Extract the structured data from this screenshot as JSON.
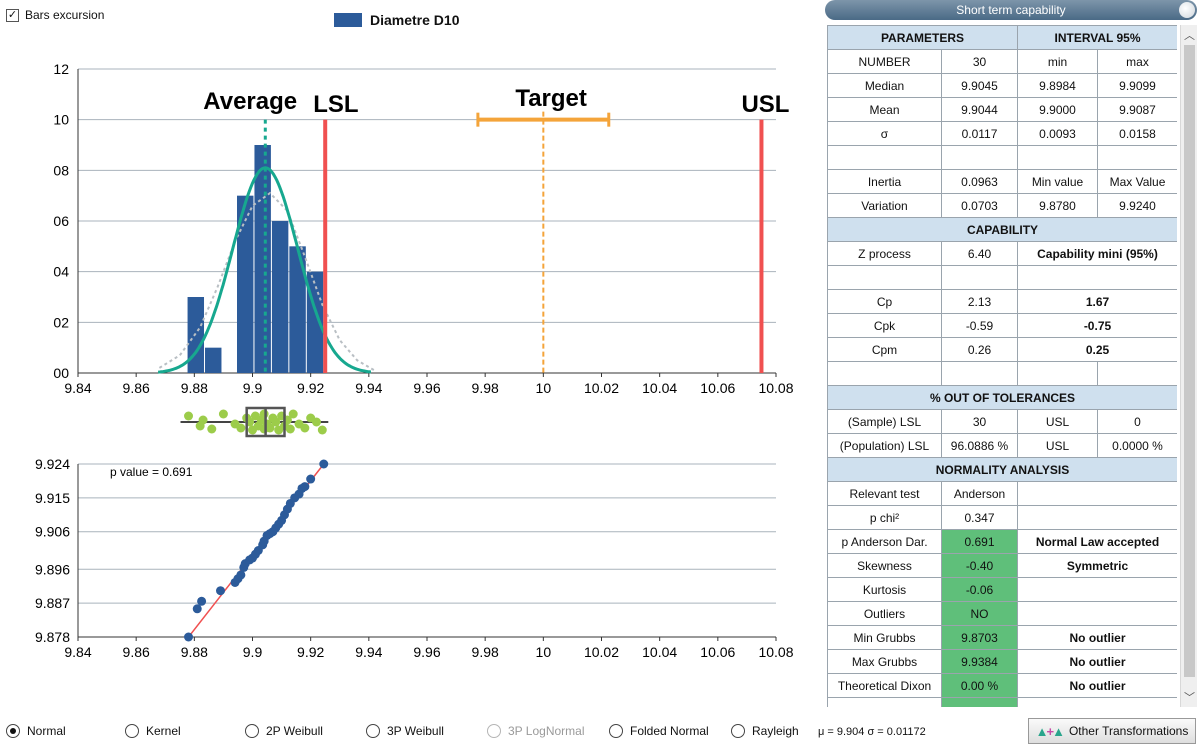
{
  "bars_excursion_label": "Bars excursion",
  "legend_label": "Diametre D10",
  "colors": {
    "bar": "#2c5b9a",
    "normal_curve": "#17a88f",
    "kernel_curve": "#b9bfc4",
    "average_line": "#17a88f",
    "spec_line": "#f05050",
    "target": "#f4a43a",
    "box_points": "#9ccc4a",
    "green_cell": "#5fbf7a",
    "fit_line": "#f05050"
  },
  "chart_data": [
    {
      "type": "bar",
      "legend": "Diametre D10",
      "bins": [
        {
          "x0": 9.8775,
          "x1": 9.8835,
          "value": 3
        },
        {
          "x0": 9.8835,
          "x1": 9.8895,
          "value": 1
        },
        {
          "x0": 9.8945,
          "x1": 9.9005,
          "value": 7
        },
        {
          "x0": 9.9005,
          "x1": 9.9065,
          "value": 9
        },
        {
          "x0": 9.9065,
          "x1": 9.9125,
          "value": 6
        },
        {
          "x0": 9.9125,
          "x1": 9.9185,
          "value": 5
        },
        {
          "x0": 9.9185,
          "x1": 9.9245,
          "value": 4
        }
      ],
      "normal_curve": {
        "mean": 9.9044,
        "sigma": 0.01117,
        "peak": 8.1
      },
      "kernel_curve": [
        [
          9.868,
          0.2
        ],
        [
          9.875,
          0.7
        ],
        [
          9.882,
          1.8
        ],
        [
          9.888,
          3.4
        ],
        [
          9.894,
          5.2
        ],
        [
          9.9,
          6.6
        ],
        [
          9.906,
          7.1
        ],
        [
          9.912,
          6.4
        ],
        [
          9.918,
          4.6
        ],
        [
          9.924,
          2.7
        ],
        [
          9.93,
          1.3
        ],
        [
          9.936,
          0.5
        ],
        [
          9.942,
          0.1
        ]
      ],
      "xlim": [
        9.84,
        10.08
      ],
      "ylim": [
        0,
        12
      ],
      "x_ticks": [
        "9.84",
        "9.86",
        "9.88",
        "9.9",
        "9.92",
        "9.94",
        "9.96",
        "9.98",
        "10",
        "10.02",
        "10.04",
        "10.06",
        "10.08"
      ],
      "x_tick_values": [
        9.84,
        9.86,
        9.88,
        9.9,
        9.92,
        9.94,
        9.96,
        9.98,
        10,
        10.02,
        10.04,
        10.06,
        10.08
      ],
      "y_ticks": [
        "00",
        "02",
        "04",
        "06",
        "08",
        "10",
        "12"
      ],
      "y_tick_values": [
        0,
        2,
        4,
        6,
        8,
        10,
        12
      ],
      "average": {
        "label": "Average",
        "x": 9.9044
      },
      "lsl": {
        "label": "LSL",
        "x": 9.925
      },
      "usl": {
        "label": "USL",
        "x": 10.075
      },
      "target": {
        "label": "Target",
        "x": 10.0,
        "min": 9.9775,
        "max": 10.0225,
        "y": 10
      }
    },
    {
      "type": "box",
      "q1": 9.898,
      "median": 9.9045,
      "q3": 9.911,
      "min": 9.878,
      "max": 9.924,
      "points": [
        9.878,
        9.882,
        9.883,
        9.886,
        9.89,
        9.894,
        9.896,
        9.898,
        9.899,
        9.9,
        9.901,
        9.902,
        9.903,
        9.904,
        9.904,
        9.905,
        9.906,
        9.907,
        9.908,
        9.909,
        9.91,
        9.911,
        9.912,
        9.913,
        9.914,
        9.916,
        9.918,
        9.92,
        9.922,
        9.924
      ]
    },
    {
      "type": "scatter",
      "annotation": "p value = 0.691",
      "points": [
        [
          9.878,
          9.878
        ],
        [
          9.881,
          9.8855
        ],
        [
          9.8825,
          9.8875
        ],
        [
          9.889,
          9.8903
        ],
        [
          9.894,
          9.8925
        ],
        [
          9.895,
          9.8935
        ],
        [
          9.896,
          9.8945
        ],
        [
          9.897,
          9.8965
        ],
        [
          9.8975,
          9.8975
        ],
        [
          9.899,
          9.8985
        ],
        [
          9.9,
          9.899
        ],
        [
          9.901,
          9.9
        ],
        [
          9.902,
          9.901
        ],
        [
          9.9035,
          9.9025
        ],
        [
          9.904,
          9.9035
        ],
        [
          9.905,
          9.905
        ],
        [
          9.906,
          9.9055
        ],
        [
          9.907,
          9.906
        ],
        [
          9.908,
          9.907
        ],
        [
          9.909,
          9.908
        ],
        [
          9.91,
          9.909
        ],
        [
          9.911,
          9.9105
        ],
        [
          9.912,
          9.912
        ],
        [
          9.913,
          9.9135
        ],
        [
          9.9145,
          9.915
        ],
        [
          9.916,
          9.916
        ],
        [
          9.917,
          9.9175
        ],
        [
          9.918,
          9.918
        ],
        [
          9.92,
          9.92
        ],
        [
          9.9245,
          9.924
        ]
      ],
      "fit_line": [
        [
          9.878,
          9.878
        ],
        [
          9.9245,
          9.924
        ]
      ],
      "xlim": [
        9.84,
        10.08
      ],
      "ylim": [
        9.878,
        9.924
      ],
      "x_ticks": [
        "9.84",
        "9.86",
        "9.88",
        "9.9",
        "9.92",
        "9.94",
        "9.96",
        "9.98",
        "10",
        "10.02",
        "10.04",
        "10.06",
        "10.08"
      ],
      "x_tick_values": [
        9.84,
        9.86,
        9.88,
        9.9,
        9.92,
        9.94,
        9.96,
        9.98,
        10,
        10.02,
        10.04,
        10.06,
        10.08
      ],
      "y_ticks": [
        "9.878",
        "9.887",
        "9.896",
        "9.906",
        "9.915",
        "9.924"
      ],
      "y_tick_values": [
        9.878,
        9.887,
        9.896,
        9.906,
        9.915,
        9.924
      ]
    }
  ],
  "panel": {
    "title": "Short term capability",
    "rows": [
      {
        "type": "header",
        "cells": [
          {
            "text": "PARAMETERS",
            "span": 2,
            "cls": "section"
          },
          {
            "text": "INTERVAL 95%",
            "span": 2,
            "cls": "section"
          }
        ]
      },
      {
        "cells": [
          {
            "text": "NUMBER"
          },
          {
            "text": "30"
          },
          {
            "text": "min"
          },
          {
            "text": "max"
          }
        ]
      },
      {
        "cells": [
          {
            "text": "Median"
          },
          {
            "text": "9.9045"
          },
          {
            "text": "9.8984"
          },
          {
            "text": "9.9099"
          }
        ]
      },
      {
        "cells": [
          {
            "text": "Mean"
          },
          {
            "text": "9.9044"
          },
          {
            "text": "9.9000"
          },
          {
            "text": "9.9087"
          }
        ]
      },
      {
        "cells": [
          {
            "text": "σ"
          },
          {
            "text": "0.0117"
          },
          {
            "text": "0.0093"
          },
          {
            "text": "0.0158"
          }
        ]
      },
      {
        "cells": [
          {
            "text": ""
          },
          {
            "text": ""
          },
          {
            "text": ""
          },
          {
            "text": ""
          }
        ]
      },
      {
        "cells": [
          {
            "text": "Inertia"
          },
          {
            "text": "0.0963"
          },
          {
            "text": "Min value"
          },
          {
            "text": "Max Value"
          }
        ]
      },
      {
        "cells": [
          {
            "text": "Variation"
          },
          {
            "text": "0.0703"
          },
          {
            "text": "9.8780"
          },
          {
            "text": "9.9240"
          }
        ]
      },
      {
        "type": "header",
        "cells": [
          {
            "text": "CAPABILITY",
            "span": 4,
            "cls": "section"
          }
        ]
      },
      {
        "cells": [
          {
            "text": "Z process"
          },
          {
            "text": "6.40"
          },
          {
            "text": "Capability mini (95%)",
            "span": 2,
            "cls": "bold"
          }
        ]
      },
      {
        "cells": [
          {
            "text": ""
          },
          {
            "text": ""
          },
          {
            "text": "",
            "span": 2
          }
        ]
      },
      {
        "cells": [
          {
            "text": "Cp"
          },
          {
            "text": "2.13"
          },
          {
            "text": "1.67",
            "span": 2,
            "cls": "bold"
          }
        ]
      },
      {
        "cells": [
          {
            "text": "Cpk"
          },
          {
            "text": "-0.59"
          },
          {
            "text": "-0.75",
            "span": 2,
            "cls": "bold"
          }
        ]
      },
      {
        "cells": [
          {
            "text": "Cpm"
          },
          {
            "text": "0.26"
          },
          {
            "text": "0.25",
            "span": 2,
            "cls": "bold"
          }
        ]
      },
      {
        "cells": [
          {
            "text": ""
          },
          {
            "text": ""
          },
          {
            "text": ""
          },
          {
            "text": ""
          }
        ]
      },
      {
        "type": "header",
        "cells": [
          {
            "text": "% OUT OF TOLERANCES",
            "span": 4,
            "cls": "section"
          }
        ]
      },
      {
        "cells": [
          {
            "text": "(Sample) LSL"
          },
          {
            "text": "30"
          },
          {
            "text": "USL"
          },
          {
            "text": "0"
          }
        ]
      },
      {
        "cells": [
          {
            "text": "(Population) LSL"
          },
          {
            "text": "96.0886 %"
          },
          {
            "text": "USL"
          },
          {
            "text": "0.0000 %"
          }
        ]
      },
      {
        "type": "header",
        "cells": [
          {
            "text": "NORMALITY ANALYSIS",
            "span": 4,
            "cls": "section"
          }
        ]
      },
      {
        "cells": [
          {
            "text": "Relevant test"
          },
          {
            "text": "Anderson"
          },
          {
            "text": "",
            "span": 2
          }
        ]
      },
      {
        "cells": [
          {
            "text": "p chi²"
          },
          {
            "text": "0.347"
          },
          {
            "text": "",
            "span": 2
          }
        ]
      },
      {
        "cells": [
          {
            "text": "p Anderson Dar."
          },
          {
            "text": "0.691",
            "cls": "green"
          },
          {
            "text": "Normal Law accepted",
            "span": 2,
            "cls": "bold"
          }
        ]
      },
      {
        "cells": [
          {
            "text": "Skewness"
          },
          {
            "text": "-0.40",
            "cls": "green"
          },
          {
            "text": "Symmetric",
            "span": 2,
            "cls": "bold"
          }
        ]
      },
      {
        "cells": [
          {
            "text": "Kurtosis"
          },
          {
            "text": "-0.06",
            "cls": "green"
          },
          {
            "text": "",
            "span": 2
          }
        ]
      },
      {
        "cells": [
          {
            "text": "Outliers"
          },
          {
            "text": "NO",
            "cls": "green"
          },
          {
            "text": "",
            "span": 2
          }
        ]
      },
      {
        "cells": [
          {
            "text": "Min Grubbs"
          },
          {
            "text": "9.8703",
            "cls": "green"
          },
          {
            "text": "No outlier",
            "span": 2,
            "cls": "bold"
          }
        ]
      },
      {
        "cells": [
          {
            "text": "Max Grubbs"
          },
          {
            "text": "9.9384",
            "cls": "green"
          },
          {
            "text": "No outlier",
            "span": 2,
            "cls": "bold"
          }
        ]
      },
      {
        "cells": [
          {
            "text": "Theoretical Dixon"
          },
          {
            "text": "0.00 %",
            "cls": "green"
          },
          {
            "text": "No outlier",
            "span": 2,
            "cls": "bold"
          }
        ]
      },
      {
        "cells": [
          {
            "text": ""
          },
          {
            "text": "",
            "cls": "green"
          },
          {
            "text": "",
            "span": 2
          }
        ]
      }
    ]
  },
  "distributions": [
    {
      "label": "Normal",
      "selected": true,
      "enabled": true
    },
    {
      "label": "Kernel",
      "selected": false,
      "enabled": true
    },
    {
      "label": "2P Weibull",
      "selected": false,
      "enabled": true
    },
    {
      "label": "3P Weibull",
      "selected": false,
      "enabled": true
    },
    {
      "label": "3P LogNormal",
      "selected": false,
      "enabled": false
    },
    {
      "label": "Folded Normal",
      "selected": false,
      "enabled": true
    },
    {
      "label": "Rayleigh",
      "selected": false,
      "enabled": true
    }
  ],
  "mu_sigma": "μ = 9.904  σ = 0.01172",
  "other_transformations_label": "Other Transformations",
  "icons": {
    "checkbox": "check-icon",
    "scroll_up": "chevron-up-icon",
    "scroll_down": "chevron-down-icon",
    "transform": "distribution-shapes-icon"
  }
}
